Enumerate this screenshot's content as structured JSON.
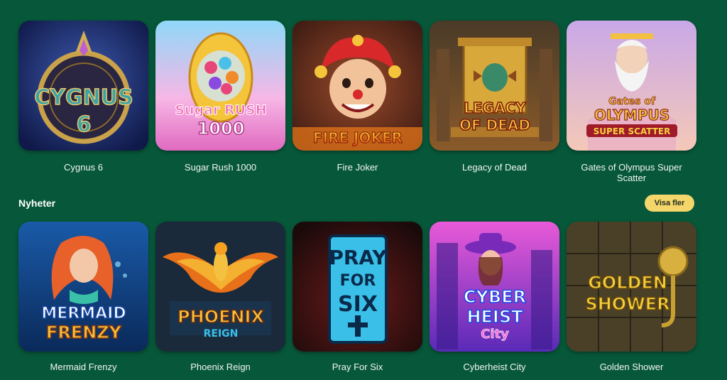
{
  "games_row": [
    {
      "title": "Cygnus 6",
      "logo": [
        "CYGNUS",
        "6"
      ]
    },
    {
      "title": "Sugar Rush 1000",
      "logo": [
        "Sugar RUSH",
        "1000"
      ]
    },
    {
      "title": "Fire Joker",
      "logo": [
        "FIRE JOKER"
      ]
    },
    {
      "title": "Legacy of Dead",
      "logo": [
        "LEGACY",
        "OF DEAD"
      ]
    },
    {
      "title": "Gates of Olympus Super Scatter",
      "logo": [
        "Gates of",
        "OLYMPUS",
        "SUPER SCATTER"
      ]
    }
  ],
  "news_section": {
    "title": "Nyheter",
    "more_label": "Visa fler",
    "games": [
      {
        "title": "Mermaid Frenzy",
        "logo": [
          "MERMAID",
          "FRENZY"
        ]
      },
      {
        "title": "Phoenix Reign",
        "logo": [
          "PHOENIX",
          "REIGN"
        ]
      },
      {
        "title": "Pray For Six",
        "logo": [
          "PRAY",
          "FOR",
          "SIX"
        ]
      },
      {
        "title": "Cyberheist City",
        "logo": [
          "CYBER",
          "HEIST",
          "City"
        ]
      },
      {
        "title": "Golden Shower",
        "logo": [
          "GOLDEN",
          "SHOWER"
        ]
      }
    ]
  },
  "colors": {
    "background": "#07583a",
    "button": "#f5d66a"
  }
}
